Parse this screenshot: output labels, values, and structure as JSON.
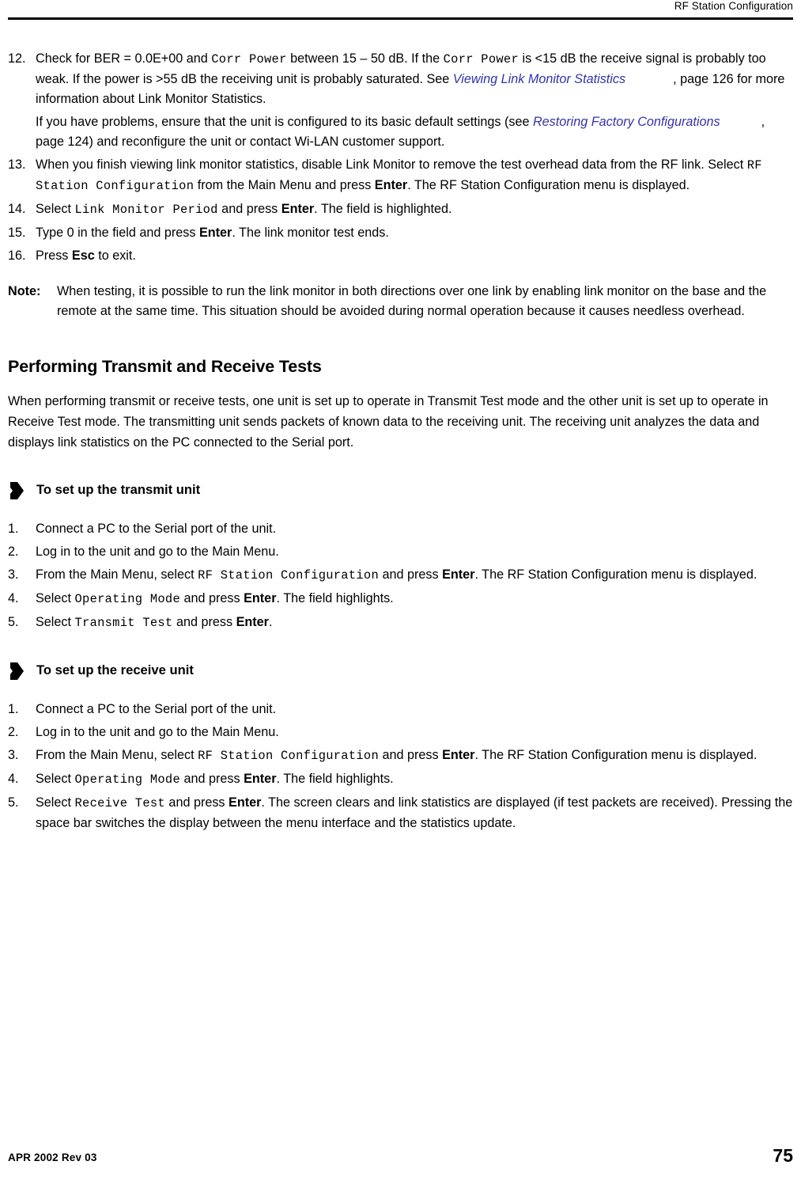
{
  "header": {
    "title": "RF Station Configuration"
  },
  "footer": {
    "revision": "APR 2002 Rev 03",
    "page_number": "75"
  },
  "colors": {
    "xref_link": "#3333AA",
    "text": "#000000",
    "rule": "#000000"
  },
  "continued_list": {
    "items": [
      {
        "number": "12.",
        "runs": [
          {
            "text": "Check for BER = 0.0E+00 and ",
            "style": "normal"
          },
          {
            "text": "Corr Power",
            "style": "mono"
          },
          {
            "text": " between 15 – 50 dB. If the ",
            "style": "normal"
          },
          {
            "text": "Corr Power",
            "style": "mono"
          },
          {
            "text": " is <15 dB the receive signal is probably too weak. If the power is >55 dB the receiving unit is probably saturated. See ",
            "style": "normal"
          },
          {
            "text": "Viewing Link Monitor Statistics",
            "style": "xref"
          },
          {
            "text": "gap",
            "style": "gap"
          },
          {
            "text": ", page 126 for more information about Link Monitor Statistics.",
            "style": "normal"
          }
        ],
        "sub_runs": [
          {
            "text": "If you have problems, ensure that the unit is configured to its basic default settings (see ",
            "style": "normal"
          },
          {
            "text": "Restoring Factory Configurations",
            "style": "xref"
          },
          {
            "text": "gap",
            "style": "gap"
          },
          {
            "text": ", page 124) and reconfigure the unit or contact Wi-LAN customer support.",
            "style": "normal"
          }
        ]
      },
      {
        "number": "13.",
        "runs": [
          {
            "text": "When you finish viewing link monitor statistics, disable Link Monitor to remove the test overhead data from the RF link. Select ",
            "style": "normal"
          },
          {
            "text": "RF Station Configuration",
            "style": "mono"
          },
          {
            "text": " from the Main Menu and press ",
            "style": "normal"
          },
          {
            "text": "Enter",
            "style": "bold"
          },
          {
            "text": ". The RF Station Configuration menu is displayed.",
            "style": "normal"
          }
        ]
      },
      {
        "number": "14.",
        "runs": [
          {
            "text": "Select ",
            "style": "normal"
          },
          {
            "text": "Link Monitor Period",
            "style": "mono"
          },
          {
            "text": " and press ",
            "style": "normal"
          },
          {
            "text": "Enter",
            "style": "bold"
          },
          {
            "text": ". The field is highlighted.",
            "style": "normal"
          }
        ]
      },
      {
        "number": "15.",
        "runs": [
          {
            "text": "Type 0 in the field and press ",
            "style": "normal"
          },
          {
            "text": "Enter",
            "style": "bold"
          },
          {
            "text": ". The link monitor test ends.",
            "style": "normal"
          }
        ]
      },
      {
        "number": "16.",
        "runs": [
          {
            "text": "Press ",
            "style": "normal"
          },
          {
            "text": "Esc",
            "style": "bold"
          },
          {
            "text": " to exit.",
            "style": "normal"
          }
        ]
      }
    ]
  },
  "note": {
    "label": "Note:",
    "text": "When testing, it is possible to run the link monitor in both directions over one link by enabling link monitor on the base and the remote at the same time. This situation should be avoided during normal operation because it causes needless overhead."
  },
  "section": {
    "heading": "Performing Transmit and Receive Tests",
    "intro": "When performing transmit or receive tests, one unit is set up to operate in Transmit Test mode and the other unit is set up to operate in Receive Test mode. The transmitting unit sends packets of known data to the receiving unit. The receiving unit analyzes the data and displays link statistics on the PC connected to the Serial port."
  },
  "procedures": [
    {
      "icon": "arrow-right-solid-icon",
      "title": "To set up the transmit unit",
      "steps": [
        {
          "number": "1.",
          "runs": [
            {
              "text": "Connect a PC to the Serial port of the unit.",
              "style": "normal"
            }
          ]
        },
        {
          "number": "2.",
          "runs": [
            {
              "text": "Log in to the unit and go to the Main Menu.",
              "style": "normal"
            }
          ]
        },
        {
          "number": "3.",
          "runs": [
            {
              "text": "From the Main Menu, select ",
              "style": "normal"
            },
            {
              "text": "RF Station Configuration",
              "style": "mono"
            },
            {
              "text": " and press ",
              "style": "normal"
            },
            {
              "text": "Enter",
              "style": "bold"
            },
            {
              "text": ". The RF Station Configuration menu is displayed.",
              "style": "normal"
            }
          ]
        },
        {
          "number": "4.",
          "runs": [
            {
              "text": "Select ",
              "style": "normal"
            },
            {
              "text": "Operating Mode",
              "style": "mono"
            },
            {
              "text": " and press ",
              "style": "normal"
            },
            {
              "text": "Enter",
              "style": "bold"
            },
            {
              "text": ". The field highlights.",
              "style": "normal"
            }
          ]
        },
        {
          "number": "5.",
          "runs": [
            {
              "text": "Select ",
              "style": "normal"
            },
            {
              "text": "Transmit Test",
              "style": "mono"
            },
            {
              "text": " and press ",
              "style": "normal"
            },
            {
              "text": "Enter",
              "style": "bold"
            },
            {
              "text": ".",
              "style": "normal"
            }
          ]
        }
      ]
    },
    {
      "icon": "arrow-right-solid-icon",
      "title": "To set up the receive unit",
      "steps": [
        {
          "number": "1.",
          "runs": [
            {
              "text": "Connect a PC to the Serial port of the unit.",
              "style": "normal"
            }
          ]
        },
        {
          "number": "2.",
          "runs": [
            {
              "text": "Log in to the unit and go to the Main Menu.",
              "style": "normal"
            }
          ]
        },
        {
          "number": "3.",
          "runs": [
            {
              "text": "From the Main Menu, select ",
              "style": "normal"
            },
            {
              "text": "RF Station Configuration",
              "style": "mono"
            },
            {
              "text": " and press ",
              "style": "normal"
            },
            {
              "text": "Enter",
              "style": "bold"
            },
            {
              "text": ". The RF Station Configuration menu is displayed.",
              "style": "normal"
            }
          ]
        },
        {
          "number": "4.",
          "runs": [
            {
              "text": "Select ",
              "style": "normal"
            },
            {
              "text": "Operating Mode",
              "style": "mono"
            },
            {
              "text": " and press ",
              "style": "normal"
            },
            {
              "text": "Enter",
              "style": "bold"
            },
            {
              "text": ". The field highlights.",
              "style": "normal"
            }
          ]
        },
        {
          "number": "5.",
          "runs": [
            {
              "text": "Select ",
              "style": "normal"
            },
            {
              "text": "Receive Test",
              "style": "mono"
            },
            {
              "text": " and press ",
              "style": "normal"
            },
            {
              "text": "Enter",
              "style": "bold"
            },
            {
              "text": ". The screen clears and link statistics are displayed (if test packets are received). Pressing the space bar switches the display between the menu interface and the statistics update.",
              "style": "normal"
            }
          ]
        }
      ]
    }
  ]
}
